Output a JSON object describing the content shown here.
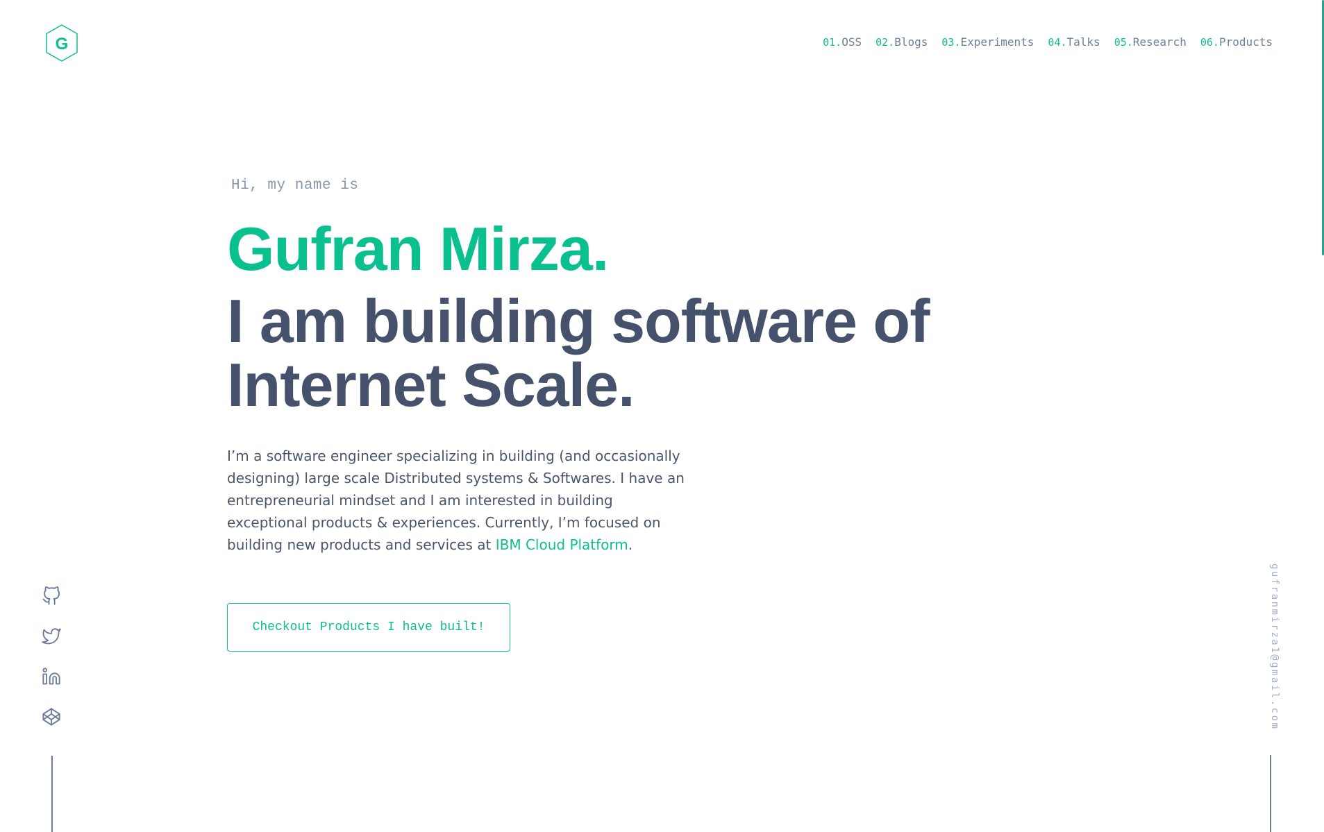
{
  "logo": {
    "letter": "G"
  },
  "nav": [
    {
      "num": "01.",
      "label": "OSS"
    },
    {
      "num": "02.",
      "label": "Blogs"
    },
    {
      "num": "03.",
      "label": "Experiments"
    },
    {
      "num": "04.",
      "label": "Talks"
    },
    {
      "num": "05.",
      "label": "Research"
    },
    {
      "num": "06.",
      "label": "Products"
    }
  ],
  "hero": {
    "intro": "Hi, my name is",
    "name": "Gufran Mirza.",
    "headline_line1": "I am building software of",
    "headline_line2": "Internet Scale.",
    "bio_text": "I’m a software engineer specializing in building (and occasionally designing) large scale Distributed systems & Softwares. I have an entrepreneurial mindset and I am interested in building exceptional products & experiences. Currently, I’m focused on building new products and services at ",
    "bio_link": "IBM Cloud Platform",
    "bio_end": ".",
    "cta_label": "Checkout Products I have built!"
  },
  "social": [
    {
      "icon": "github-icon"
    },
    {
      "icon": "twitter-icon"
    },
    {
      "icon": "linkedin-icon"
    },
    {
      "icon": "codepen-icon"
    }
  ],
  "email": "gufranmirza1@gmail.com",
  "colors": {
    "accent": "#0bbf8f",
    "heading": "#46526b",
    "text": "#4a556c",
    "muted": "#8796ad"
  }
}
